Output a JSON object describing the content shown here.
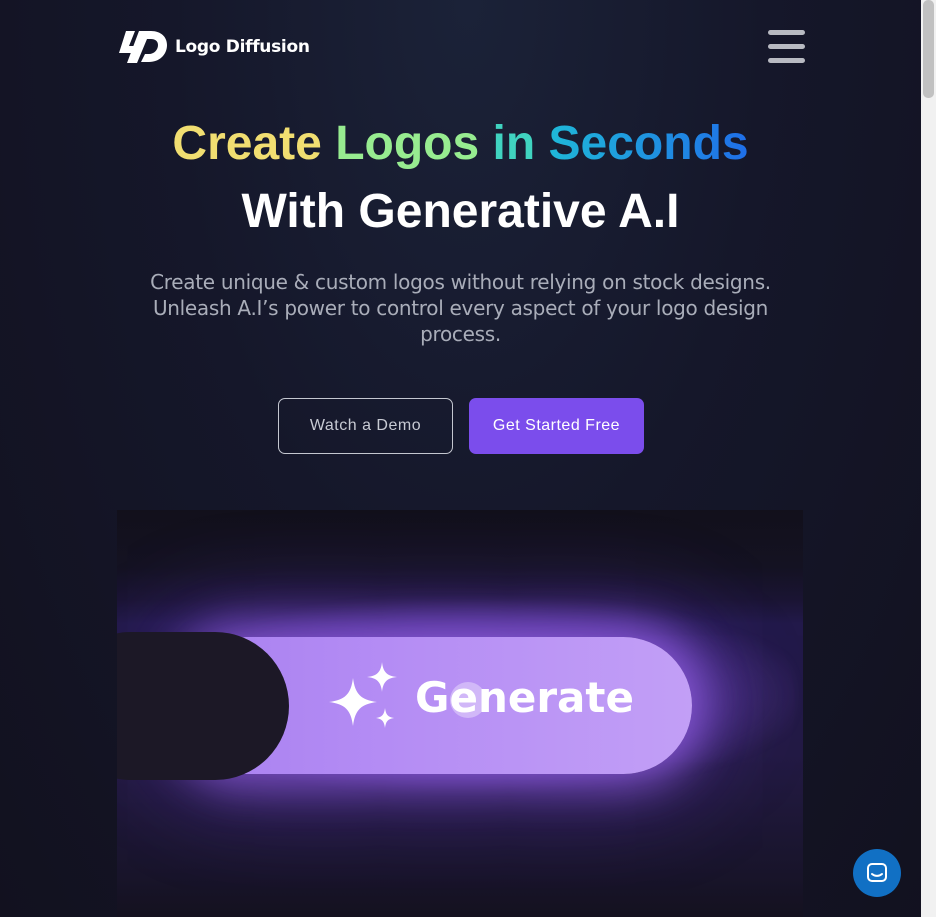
{
  "header": {
    "brand_name": "Logo Diffusion",
    "logo_icon": "logo-diffusion-mark",
    "menu_icon": "hamburger-icon"
  },
  "hero": {
    "headline_words": [
      "Create",
      "Logos",
      "in",
      "Seconds"
    ],
    "headline_line2": "With Generative A.I",
    "subtitle": "Create unique & custom logos without relying on stock designs. Unleash A.I’s power to control every aspect of your logo design process."
  },
  "cta": {
    "demo_label": "Watch a Demo",
    "start_label": "Get Started Free"
  },
  "demo": {
    "generate_label": "Generate",
    "sparkle_icon": "sparkles-icon"
  },
  "chat": {
    "icon": "chat-bubble-icon"
  },
  "colors": {
    "accent": "#7b4dec",
    "gradient_stops": [
      "#f5dc6a",
      "#8bf08e",
      "#22c4d6",
      "#1f6ee8"
    ],
    "chat": "#1170c4"
  }
}
